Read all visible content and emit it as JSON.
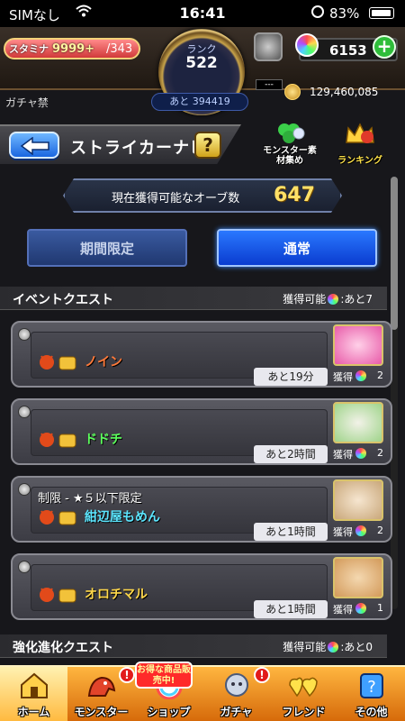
{
  "status": {
    "carrier": "SIMなし",
    "time": "16:41",
    "battery": "83%"
  },
  "header": {
    "stamina_label": "スタミナ",
    "stamina_value": "9999+",
    "stamina_max": "/343",
    "rank_label": "ランク",
    "rank_value": "522",
    "exp_remaining": "あと 394419",
    "orbs": "6153",
    "gem_slot": "---",
    "gacha_ban": "ガチャ禁",
    "coins": "129,460,085"
  },
  "nav": {
    "title": "ストライカーナビ",
    "help": "?",
    "monster_material": "モンスター素材集め",
    "ranking": "ランキング"
  },
  "orb_panel": {
    "label": "現在獲得可能なオーブ数",
    "value": "647"
  },
  "tabs": {
    "limited": "期間限定",
    "normal": "通常"
  },
  "section_event": {
    "title": "イベントクエスト",
    "available": "獲得可能",
    "remaining": ":あと7"
  },
  "quests": [
    {
      "limit": "",
      "name": "ノイン",
      "name_color": "#ff7a3a",
      "time": "あと19分",
      "reward_label": "獲得",
      "reward_count": "2",
      "thumb_color": "#e85aa8"
    },
    {
      "limit": "",
      "name": "ドドチ",
      "name_color": "#5cff5c",
      "time": "あと2時間",
      "reward_label": "獲得",
      "reward_count": "2",
      "thumb_color": "#9fd48a"
    },
    {
      "limit": "制限 - ★５以下限定",
      "name": "紺辺屋もめん",
      "name_color": "#5ce6ff",
      "time": "あと1時間",
      "reward_label": "獲得",
      "reward_count": "2",
      "thumb_color": "#c9a77a"
    },
    {
      "limit": "",
      "name": "オロチマル",
      "name_color": "#ffd84a",
      "time": "あと1時間",
      "reward_label": "獲得",
      "reward_count": "1",
      "thumb_color": "#d39a5a"
    }
  ],
  "section_evolve": {
    "title": "強化進化クエスト",
    "available": "獲得可能",
    "remaining": ":あと0"
  },
  "bottom_nav": [
    {
      "label": "ホーム"
    },
    {
      "label": "モンスター"
    },
    {
      "label": "ショップ"
    },
    {
      "label": "ガチャ"
    },
    {
      "label": "フレンド"
    },
    {
      "label": "その他"
    }
  ],
  "shop_sale": "お得な商品販売中!",
  "badge_mark": "!"
}
